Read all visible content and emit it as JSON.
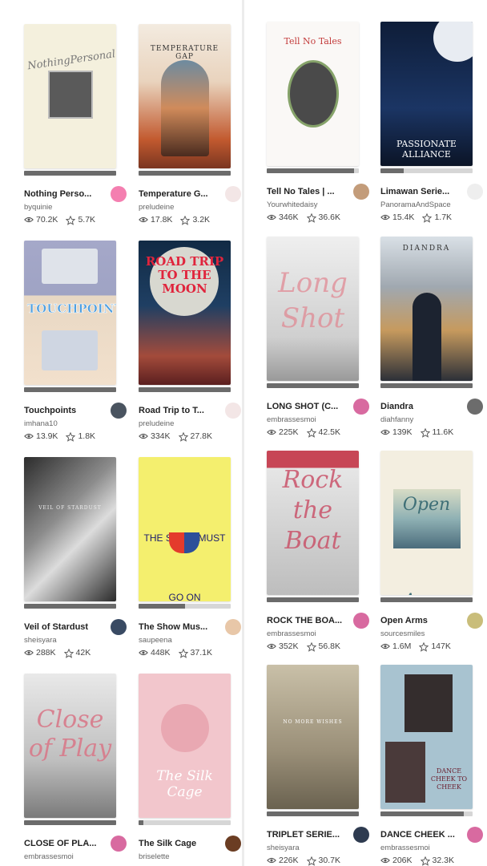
{
  "left": [
    {
      "title": "Nothing Perso...",
      "author": "byquinie",
      "reads": "70.2K",
      "votes": "5.7K",
      "progress": 1.0,
      "cover_text": "NothingPersonal",
      "cover_style": "nothing",
      "avatar_color": "#f47fb0"
    },
    {
      "title": "Temperature G...",
      "author": "preludeine",
      "reads": "17.8K",
      "votes": "3.2K",
      "progress": 1.0,
      "cover_text": "TEMPERATURE GAP",
      "cover_style": "temp",
      "avatar_color": "#f3e6e6"
    },
    {
      "title": "Touchpoints",
      "author": "imhana10",
      "reads": "13.9K",
      "votes": "1.8K",
      "progress": 1.0,
      "cover_text": "TOUCHPOINTS",
      "cover_style": "touch",
      "avatar_color": "#4a5460"
    },
    {
      "title": "Road Trip to T...",
      "author": "preludeine",
      "reads": "334K",
      "votes": "27.8K",
      "progress": 1.0,
      "cover_text": "ROAD TRIP TO THE MOON",
      "cover_style": "road",
      "avatar_color": "#f3e6e6"
    },
    {
      "title": "Veil of Stardust",
      "author": "sheisyara",
      "reads": "288K",
      "votes": "42K",
      "progress": 1.0,
      "cover_text": "VEIL OF STARDUST",
      "cover_style": "veil",
      "avatar_color": "#394a63"
    },
    {
      "title": "The Show Mus...",
      "author": "saupeena",
      "reads": "448K",
      "votes": "37.1K",
      "progress": 0.5,
      "cover_text": "THE SHOW MUST GO ON",
      "cover_style": "show",
      "avatar_color": "#e8c7a8"
    },
    {
      "title": "CLOSE OF PLA...",
      "author": "embrassesmoi",
      "reads": "",
      "votes": "",
      "progress": 1.0,
      "cover_text": "Close of Play",
      "cover_style": "close",
      "avatar_color": "#d86aa0"
    },
    {
      "title": "The Silk Cage",
      "author": "briselette",
      "reads": "",
      "votes": "",
      "progress": 0.05,
      "cover_text": "The Silk Cage",
      "cover_style": "silk",
      "avatar_color": "#6b3d23"
    }
  ],
  "right": [
    {
      "title": "Tell No Tales | ...",
      "author": "Yourwhitedaisy",
      "reads": "346K",
      "votes": "36.6K",
      "progress": 0.95,
      "cover_text": "Tell No Tales",
      "cover_style": "tell",
      "avatar_color": "#c39c7a"
    },
    {
      "title": "Limawan Serie...",
      "author": "PanoramaAndSpace",
      "reads": "15.4K",
      "votes": "1.7K",
      "progress": 0.25,
      "cover_text": "PASSIONATE ALLIANCE",
      "cover_style": "passion",
      "avatar_color": "#eeeeee"
    },
    {
      "title": "LONG SHOT (C...",
      "author": "embrassesmoi",
      "reads": "225K",
      "votes": "42.5K",
      "progress": 1.0,
      "cover_text": "Long Shot",
      "cover_style": "long",
      "avatar_color": "#d86aa0"
    },
    {
      "title": "Diandra",
      "author": "diahfanny",
      "reads": "139K",
      "votes": "11.6K",
      "progress": 1.0,
      "cover_text": "DIANDRA",
      "cover_style": "diandra",
      "avatar_color": "#6c6c6c"
    },
    {
      "title": "ROCK THE BOA...",
      "author": "embrassesmoi",
      "reads": "352K",
      "votes": "56.8K",
      "progress": 1.0,
      "cover_text": "Rock the Boat",
      "cover_style": "rock",
      "avatar_color": "#d86aa0"
    },
    {
      "title": "Open Arms",
      "author": "sourcesmiles",
      "reads": "1.6M",
      "votes": "147K",
      "progress": 1.0,
      "cover_text": "Open Arms",
      "cover_style": "open",
      "avatar_color": "#c9bd7a"
    },
    {
      "title": "TRIPLET SERIE...",
      "author": "sheisyara",
      "reads": "226K",
      "votes": "30.7K",
      "progress": 1.0,
      "cover_text": "NO MORE WISHES",
      "cover_style": "triplet",
      "avatar_color": "#2e3b50"
    },
    {
      "title": "DANCE CHEEK ...",
      "author": "embrassesmoi",
      "reads": "206K",
      "votes": "32.3K",
      "progress": 0.9,
      "cover_text": "DANCE CHEEK TO CHEEK",
      "cover_style": "dance",
      "avatar_color": "#d86aa0"
    }
  ]
}
